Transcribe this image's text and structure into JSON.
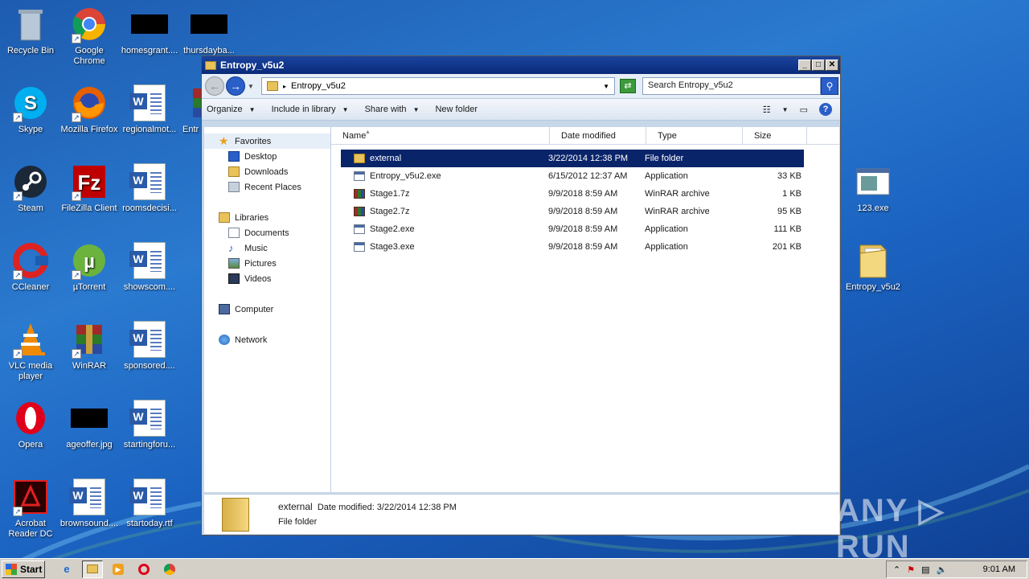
{
  "desktop": {
    "icons": [
      {
        "label": "Recycle Bin"
      },
      {
        "label": "Google Chrome"
      },
      {
        "label": "homesgrant...."
      },
      {
        "label": "thursdayba..."
      },
      {
        "label": "Skype"
      },
      {
        "label": "Mozilla Firefox"
      },
      {
        "label": "regionalmot..."
      },
      {
        "label": "Entr"
      },
      {
        "label": "Steam"
      },
      {
        "label": "FileZilla Client"
      },
      {
        "label": "roomsdecisi..."
      },
      {
        "label": "CCleaner"
      },
      {
        "label": "µTorrent"
      },
      {
        "label": "showscom...."
      },
      {
        "label": "VLC media player"
      },
      {
        "label": "WinRAR"
      },
      {
        "label": "sponsored...."
      },
      {
        "label": "Opera"
      },
      {
        "label": "ageoffer.jpg"
      },
      {
        "label": "startingforu..."
      },
      {
        "label": "Acrobat Reader DC"
      },
      {
        "label": "brownsound...."
      },
      {
        "label": "startoday.rtf"
      },
      {
        "label": "123.exe"
      },
      {
        "label": "Entropy_v5u2"
      }
    ]
  },
  "window": {
    "title": "Entropy_v5u2",
    "address": "Entropy_v5u2",
    "search_placeholder": "Search Entropy_v5u2",
    "toolbar": {
      "organize": "Organize",
      "include": "Include in library",
      "share": "Share with",
      "new_folder": "New folder"
    },
    "nav": {
      "favorites": "Favorites",
      "desktop": "Desktop",
      "downloads": "Downloads",
      "recent": "Recent Places",
      "libraries": "Libraries",
      "documents": "Documents",
      "music": "Music",
      "pictures": "Pictures",
      "videos": "Videos",
      "computer": "Computer",
      "network": "Network"
    },
    "columns": {
      "name": "Name",
      "date": "Date modified",
      "type": "Type",
      "size": "Size"
    },
    "files": [
      {
        "name": "external",
        "date": "3/22/2014 12:38 PM",
        "type": "File folder",
        "size": ""
      },
      {
        "name": "Entropy_v5u2.exe",
        "date": "6/15/2012 12:37 AM",
        "type": "Application",
        "size": "33 KB"
      },
      {
        "name": "Stage1.7z",
        "date": "9/9/2018 8:59 AM",
        "type": "WinRAR archive",
        "size": "1 KB"
      },
      {
        "name": "Stage2.7z",
        "date": "9/9/2018 8:59 AM",
        "type": "WinRAR archive",
        "size": "95 KB"
      },
      {
        "name": "Stage2.exe",
        "date": "9/9/2018 8:59 AM",
        "type": "Application",
        "size": "111 KB"
      },
      {
        "name": "Stage3.exe",
        "date": "9/9/2018 8:59 AM",
        "type": "Application",
        "size": "201 KB"
      }
    ],
    "details": {
      "name": "external",
      "date_label": "Date modified: 3/22/2014 12:38 PM",
      "type": "File folder"
    }
  },
  "taskbar": {
    "start": "Start",
    "clock": "9:01 AM"
  },
  "watermark": "ANY ▷ RUN"
}
